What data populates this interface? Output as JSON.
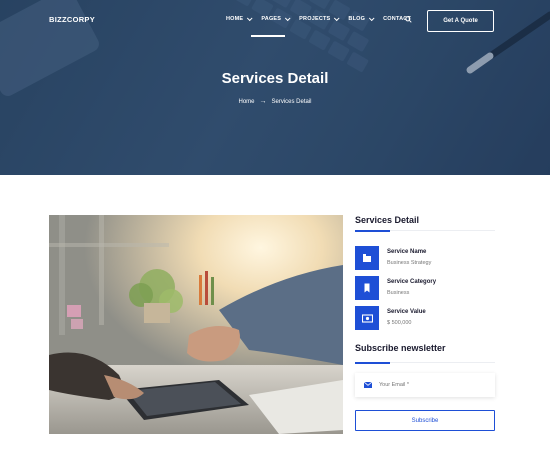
{
  "header": {
    "logo": "BIZZCORPY",
    "nav": [
      {
        "label": "HOME",
        "has_dropdown": true
      },
      {
        "label": "PAGES",
        "has_dropdown": true,
        "active": true
      },
      {
        "label": "PROJECTS",
        "has_dropdown": true
      },
      {
        "label": "BLOG",
        "has_dropdown": true
      },
      {
        "label": "CONTACT",
        "has_dropdown": false
      }
    ],
    "search_icon": "search-icon",
    "cta_label": "Get A Quote"
  },
  "hero": {
    "title": "Services Detail",
    "breadcrumb": {
      "home": "Home",
      "separator": "→",
      "current": "Services Detail"
    }
  },
  "sidebar": {
    "title": "Services Detail",
    "items": [
      {
        "icon": "building-icon",
        "label": "Service Name",
        "value": "Business Strategy"
      },
      {
        "icon": "bookmark-icon",
        "label": "Service Category",
        "value": "Business"
      },
      {
        "icon": "money-icon",
        "label": "Service Value",
        "value": "$ 500,000"
      }
    ]
  },
  "newsletter": {
    "title": "Subscribe newsletter",
    "email_placeholder": "Your Email *",
    "button_label": "Subscribe"
  },
  "colors": {
    "accent": "#1e4fd6",
    "hero_overlay": "#34506e"
  }
}
